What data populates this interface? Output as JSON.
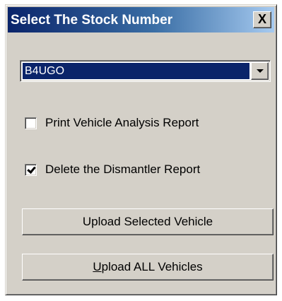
{
  "window": {
    "title": "Select The Stock Number",
    "close_glyph": "X"
  },
  "stock_select": {
    "selected_value": "B4UGO",
    "arrow_icon": "chevron-down-icon"
  },
  "options": {
    "print_report": {
      "label": "Print Vehicle Analysis Report",
      "checked": false
    },
    "delete_report": {
      "label": "Delete the Dismantler Report",
      "checked": true
    }
  },
  "buttons": {
    "upload_selected": "Upload Selected Vehicle",
    "upload_all_mnemonic": "U",
    "upload_all_rest": "pload ALL Vehicles"
  },
  "colors": {
    "dialog_face": "#d4d0c8",
    "titlebar_start": "#0a246a",
    "titlebar_end": "#a6caf0",
    "selection": "#0a246a"
  }
}
